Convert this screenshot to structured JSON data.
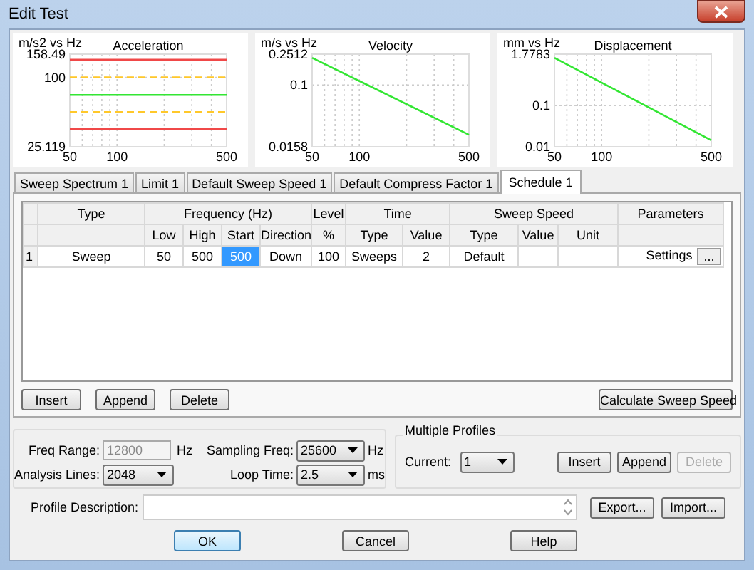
{
  "window": {
    "title": "Edit Test"
  },
  "charts": [
    {
      "kind": "limits",
      "title": "Acceleration",
      "unit_label": "m/s2 vs Hz",
      "y_labels": [
        "158.49",
        "100",
        "25.119"
      ],
      "x_labels": [
        "50",
        "100",
        "500"
      ]
    },
    {
      "kind": "slope",
      "title": "Velocity",
      "unit_label": "m/s vs Hz",
      "y_labels": [
        "0.2512",
        "0.1",
        "0.0158"
      ],
      "x_labels": [
        "50",
        "100",
        "500"
      ]
    },
    {
      "kind": "slope",
      "title": "Displacement",
      "unit_label": "mm vs Hz",
      "y_labels": [
        "1.7783",
        "0.1",
        "0.01"
      ],
      "x_labels": [
        "50",
        "100",
        "500"
      ]
    }
  ],
  "tabs": [
    {
      "label": "Sweep Spectrum 1",
      "selected": false
    },
    {
      "label": "Limit 1",
      "selected": false
    },
    {
      "label": "Default Sweep Speed 1",
      "selected": false
    },
    {
      "label": "Default Compress Factor 1",
      "selected": false
    },
    {
      "label": "Schedule 1",
      "selected": true
    }
  ],
  "table": {
    "header_groups": [
      {
        "label": "Type"
      },
      {
        "label": "Frequency (Hz)",
        "columns": [
          "Low",
          "High",
          "Start",
          "Direction"
        ]
      },
      {
        "label": "Level",
        "columns": [
          "%"
        ]
      },
      {
        "label": "Time",
        "columns": [
          "Type",
          "Value"
        ]
      },
      {
        "label": "Sweep Speed",
        "columns": [
          "Type",
          "Value",
          "Unit"
        ]
      },
      {
        "label": "Parameters"
      }
    ],
    "rows": [
      {
        "index": "1",
        "cells": [
          {
            "text": "Sweep",
            "selected": false
          },
          {
            "text": "50",
            "selected": false
          },
          {
            "text": "500",
            "selected": false
          },
          {
            "text": "500",
            "selected": true
          },
          {
            "text": "Down",
            "selected": false
          },
          {
            "text": "100",
            "selected": false
          },
          {
            "text": "Sweeps",
            "selected": false
          },
          {
            "text": "2",
            "selected": false
          },
          {
            "text": "Default",
            "selected": false
          },
          {
            "selected": false
          },
          {
            "selected": false
          },
          {
            "text": "Settings",
            "button": "...",
            "selected": false
          }
        ]
      }
    ]
  },
  "table_buttons": [
    {
      "label": "Insert"
    },
    {
      "label": "Append"
    },
    {
      "label": "Delete"
    },
    {
      "label": "Calculate Sweep Speed"
    }
  ],
  "settings": {
    "freq_range": {
      "label": "Freq Range:",
      "value": "12800",
      "unit": "Hz",
      "disabled": true
    },
    "analysis_lines": {
      "label": "Analysis Lines:",
      "value": "2048"
    },
    "sampling_freq": {
      "label": "Sampling Freq:",
      "value": "25600",
      "unit": "Hz"
    },
    "loop_time": {
      "label": "Loop Time:",
      "value": "2.5",
      "unit": "ms"
    }
  },
  "multiple_profiles": {
    "title": "Multiple Profiles",
    "current": {
      "label": "Current:",
      "value": "1"
    },
    "buttons": [
      {
        "label": "Insert",
        "disabled": false
      },
      {
        "label": "Append",
        "disabled": false
      },
      {
        "label": "Delete",
        "disabled": true
      }
    ]
  },
  "profile_description": {
    "label": "Profile Description:",
    "buttons": [
      "Export...",
      "Import..."
    ]
  },
  "footer_buttons": [
    {
      "label": "OK",
      "default": true
    },
    {
      "label": "Cancel",
      "default": false
    },
    {
      "label": "Help",
      "default": false
    }
  ]
}
